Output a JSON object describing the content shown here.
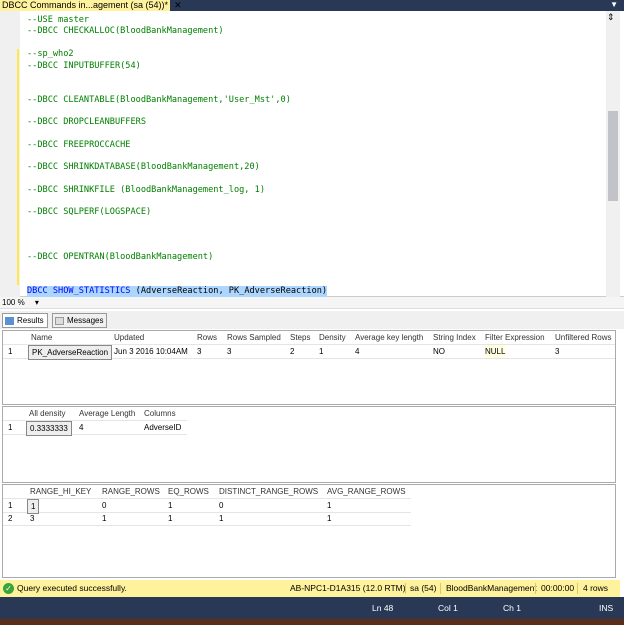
{
  "window": {
    "tab_title": "DBCC Commands in...agement (sa (54))*",
    "close": "✕"
  },
  "editor": {
    "lines": [
      "--USE master",
      "--DBCC CHECKALLOC(BloodBankManagement)",
      "--sp_who2",
      "--DBCC INPUTBUFFER(54)",
      "--DBCC CLEANTABLE(BloodBankManagement,'User_Mst',0)",
      "--DBCC DROPCLEANBUFFERS",
      "--DBCC FREEPROCCACHE",
      "--DBCC SHRINKDATABASE(BloodBankManagement,20)",
      "--DBCC SHRINKFILE (BloodBankManagement_log, 1)",
      "--DBCC SQLPERF(LOGSPACE)",
      "--DBCC OPENTRAN(BloodBankManagement)"
    ],
    "selected_keyword": "DBCC SHOW_STATISTICS",
    "selected_args": "(AdverseReaction, PK_AdverseReaction)"
  },
  "zoom": {
    "value": "100 %"
  },
  "result_tabs": {
    "results": "Results",
    "messages": "Messages"
  },
  "grid1": {
    "headers": [
      "Name",
      "Updated",
      "Rows",
      "Rows Sampled",
      "Steps",
      "Density",
      "Average key length",
      "String Index",
      "Filter Expression",
      "Unfiltered Rows"
    ],
    "rows": [
      {
        "num": "1",
        "cells": [
          "PK_AdverseReaction",
          "Jun  3 2016 10:04AM",
          "3",
          "3",
          "2",
          "1",
          "4",
          "NO",
          "NULL",
          "3"
        ]
      }
    ]
  },
  "grid2": {
    "headers": [
      "All density",
      "Average Length",
      "Columns"
    ],
    "rows": [
      {
        "num": "1",
        "cells": [
          "0.3333333",
          "4",
          "AdverseID"
        ]
      }
    ]
  },
  "grid3": {
    "headers": [
      "RANGE_HI_KEY",
      "RANGE_ROWS",
      "EQ_ROWS",
      "DISTINCT_RANGE_ROWS",
      "AVG_RANGE_ROWS"
    ],
    "rows": [
      {
        "num": "1",
        "cells": [
          "1",
          "0",
          "1",
          "0",
          "1"
        ]
      },
      {
        "num": "2",
        "cells": [
          "3",
          "1",
          "1",
          "1",
          "1"
        ]
      }
    ]
  },
  "status": {
    "message": "Query executed successfully.",
    "server": "AB-NPC1-D1A315 (12.0 RTM)",
    "user": "sa (54)",
    "database": "BloodBankManagement",
    "time": "00:00:00",
    "rows": "4 rows"
  },
  "bottom": {
    "ln": "Ln 48",
    "col": "Col 1",
    "ch": "Ch 1",
    "mode": "INS"
  }
}
